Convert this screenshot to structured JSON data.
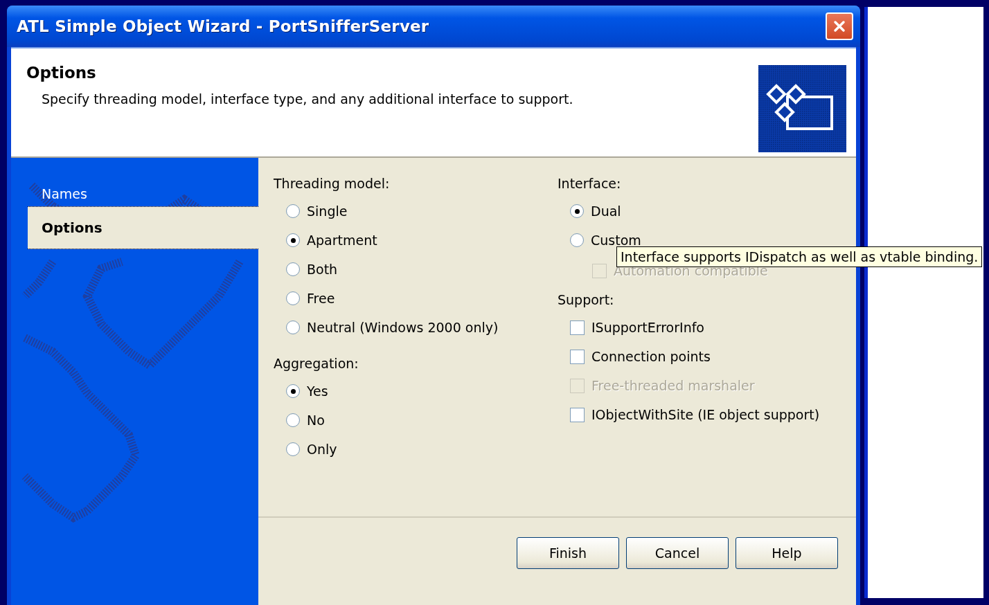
{
  "window": {
    "title": "ATL Simple Object Wizard - PortSnifferServer"
  },
  "header": {
    "title": "Options",
    "subtitle": "Specify threading model, interface type, and any additional interface to support."
  },
  "sidebar": {
    "items": [
      {
        "label": "Names",
        "selected": false
      },
      {
        "label": "Options",
        "selected": true
      }
    ]
  },
  "columns": [
    [
      {
        "title": "Threading model:",
        "items": [
          {
            "kind": "radio",
            "label": "Single",
            "selected": false
          },
          {
            "kind": "radio",
            "label": "Apartment",
            "selected": true
          },
          {
            "kind": "radio",
            "label": "Both",
            "selected": false
          },
          {
            "kind": "radio",
            "label": "Free",
            "selected": false
          },
          {
            "kind": "radio",
            "label": "Neutral (Windows 2000 only)",
            "selected": false
          }
        ]
      },
      {
        "title": "Aggregation:",
        "items": [
          {
            "kind": "radio",
            "label": "Yes",
            "selected": true
          },
          {
            "kind": "radio",
            "label": "No",
            "selected": false
          },
          {
            "kind": "radio",
            "label": "Only",
            "selected": false
          }
        ]
      }
    ],
    [
      {
        "title": "Interface:",
        "items": [
          {
            "kind": "radio",
            "label": "Dual",
            "selected": true
          },
          {
            "kind": "radio",
            "label": "Custom",
            "selected": false,
            "children": [
              {
                "kind": "checkbox",
                "label": "Automation compatible",
                "checked": false,
                "disabled": true
              }
            ]
          }
        ]
      },
      {
        "title": "Support:",
        "items": [
          {
            "kind": "checkbox",
            "label": "ISupportErrorInfo",
            "checked": false,
            "disabled": false
          },
          {
            "kind": "checkbox",
            "label": "Connection points",
            "checked": false,
            "disabled": false
          },
          {
            "kind": "checkbox",
            "label": "Free-threaded marshaler",
            "checked": false,
            "disabled": true
          },
          {
            "kind": "checkbox",
            "label": "IObjectWithSite (IE object support)",
            "checked": false,
            "disabled": false
          }
        ]
      }
    ]
  ],
  "tooltip": {
    "text": "Interface supports IDispatch as well as vtable binding."
  },
  "buttons": [
    "Finish",
    "Cancel",
    "Help"
  ]
}
